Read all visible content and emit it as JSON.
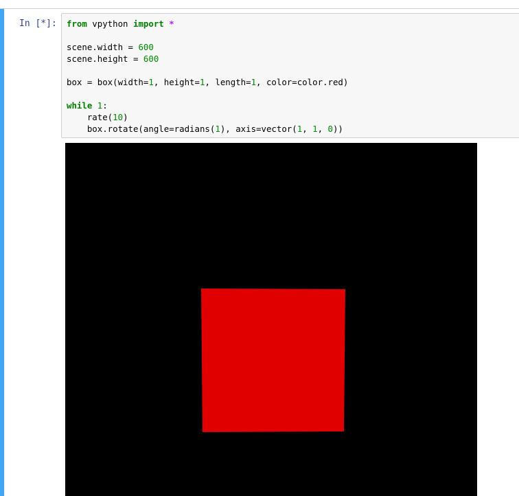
{
  "cell": {
    "prompt": "In [*]:",
    "code_lines": [
      [
        {
          "t": "from",
          "c": "kw"
        },
        {
          "t": " vpython ",
          "c": ""
        },
        {
          "t": "import",
          "c": "kw"
        },
        {
          "t": " ",
          "c": ""
        },
        {
          "t": "*",
          "c": "op"
        }
      ],
      [],
      [
        {
          "t": "scene.width = ",
          "c": ""
        },
        {
          "t": "600",
          "c": "num"
        }
      ],
      [
        {
          "t": "scene.height = ",
          "c": ""
        },
        {
          "t": "600",
          "c": "num"
        }
      ],
      [],
      [
        {
          "t": "box = box(width=",
          "c": ""
        },
        {
          "t": "1",
          "c": "num"
        },
        {
          "t": ", height=",
          "c": ""
        },
        {
          "t": "1",
          "c": "num"
        },
        {
          "t": ", length=",
          "c": ""
        },
        {
          "t": "1",
          "c": "num"
        },
        {
          "t": ", color=color.red)",
          "c": ""
        }
      ],
      [],
      [
        {
          "t": "while",
          "c": "kw"
        },
        {
          "t": " ",
          "c": ""
        },
        {
          "t": "1",
          "c": "num"
        },
        {
          "t": ":",
          "c": ""
        }
      ],
      [
        {
          "t": "    rate(",
          "c": ""
        },
        {
          "t": "10",
          "c": "num"
        },
        {
          "t": ")",
          "c": ""
        }
      ],
      [
        {
          "t": "    box.rotate(angle=radians(",
          "c": ""
        },
        {
          "t": "1",
          "c": "num"
        },
        {
          "t": "), axis=vector(",
          "c": ""
        },
        {
          "t": "1",
          "c": "num"
        },
        {
          "t": ", ",
          "c": ""
        },
        {
          "t": "1",
          "c": "num"
        },
        {
          "t": ", ",
          "c": ""
        },
        {
          "t": "0",
          "c": "num"
        },
        {
          "t": "))",
          "c": ""
        }
      ]
    ]
  },
  "output": {
    "background_color": "#000000",
    "box_color": "#e00000"
  }
}
